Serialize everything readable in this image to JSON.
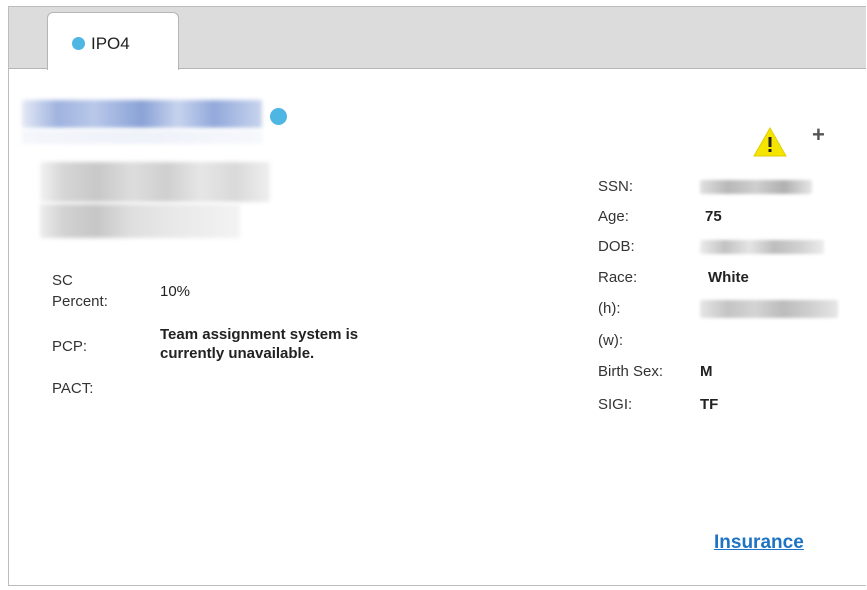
{
  "tab": {
    "label": "IPO4",
    "dot_color": "#4db6e2"
  },
  "icons": {
    "status": "status-dot-icon",
    "warning": "warning-icon",
    "add": "plus-icon"
  },
  "left_fields": {
    "sc_label_line1": "SC",
    "sc_label_line2": "Percent:",
    "sc_value": "10%",
    "pcp_label": "PCP:",
    "pcp_value_line1": "Team assignment system is",
    "pcp_value_line2": "currently unavailable.",
    "pact_label": "PACT:"
  },
  "right_fields": {
    "ssn_label": "SSN:",
    "age_label": "Age:",
    "age_value": "75",
    "dob_label": "DOB:",
    "race_label": "Race:",
    "race_value": "White",
    "phone_h_label": "(h):",
    "phone_w_label": "(w):",
    "birth_sex_label": "Birth Sex:",
    "birth_sex_value": "M",
    "sigi_label": "SIGI:",
    "sigi_value": "TF"
  },
  "links": {
    "insurance": "Insurance"
  },
  "colors": {
    "accent": "#4db6e2",
    "link": "#1f73c4",
    "warning": "#f5e400"
  }
}
